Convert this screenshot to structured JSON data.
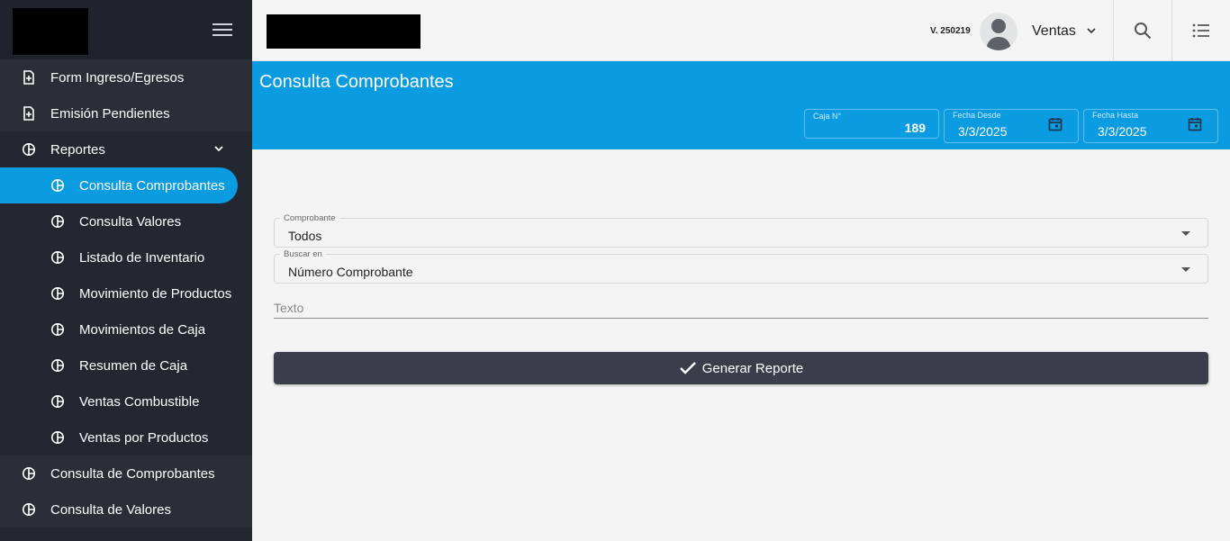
{
  "topbar": {
    "version": "V. 250219",
    "user_label": "Ventas"
  },
  "sidebar": {
    "items": [
      {
        "label": "Form Ingreso/Egresos",
        "icon": "file-plus-icon"
      },
      {
        "label": "Emisión Pendientes",
        "icon": "file-plus-icon"
      },
      {
        "label": "Reportes",
        "icon": "pie-chart-icon"
      },
      {
        "label": "Consulta Comprobantes",
        "icon": "pie-chart-icon"
      },
      {
        "label": "Consulta Valores",
        "icon": "pie-chart-icon"
      },
      {
        "label": "Listado de Inventario",
        "icon": "pie-chart-icon"
      },
      {
        "label": "Movimiento de Productos",
        "icon": "pie-chart-icon"
      },
      {
        "label": "Movimientos de Caja",
        "icon": "pie-chart-icon"
      },
      {
        "label": "Resumen de Caja",
        "icon": "pie-chart-icon"
      },
      {
        "label": "Ventas Combustible",
        "icon": "pie-chart-icon"
      },
      {
        "label": "Ventas por Productos",
        "icon": "pie-chart-icon"
      },
      {
        "label": "Consulta de Comprobantes",
        "icon": "pie-chart-icon"
      },
      {
        "label": "Consulta de Valores",
        "icon": "pie-chart-icon"
      }
    ]
  },
  "header": {
    "title": "Consulta Comprobantes",
    "caja_label": "Caja N°",
    "caja_value": "189",
    "fecha_desde_label": "Fecha Desde",
    "fecha_desde_value": "3/3/2025",
    "fecha_hasta_label": "Fecha Hasta",
    "fecha_hasta_value": "3/3/2025"
  },
  "form": {
    "comprobante_label": "Comprobante",
    "comprobante_value": "Todos",
    "buscar_label": "Buscar en",
    "buscar_value": "Número Comprobante",
    "texto_placeholder": "Texto",
    "generate_label": "Generar Reporte"
  },
  "colors": {
    "accent": "#0a9be0",
    "sidebar_bg": "#232730",
    "button_bg": "#3a3e4b"
  }
}
